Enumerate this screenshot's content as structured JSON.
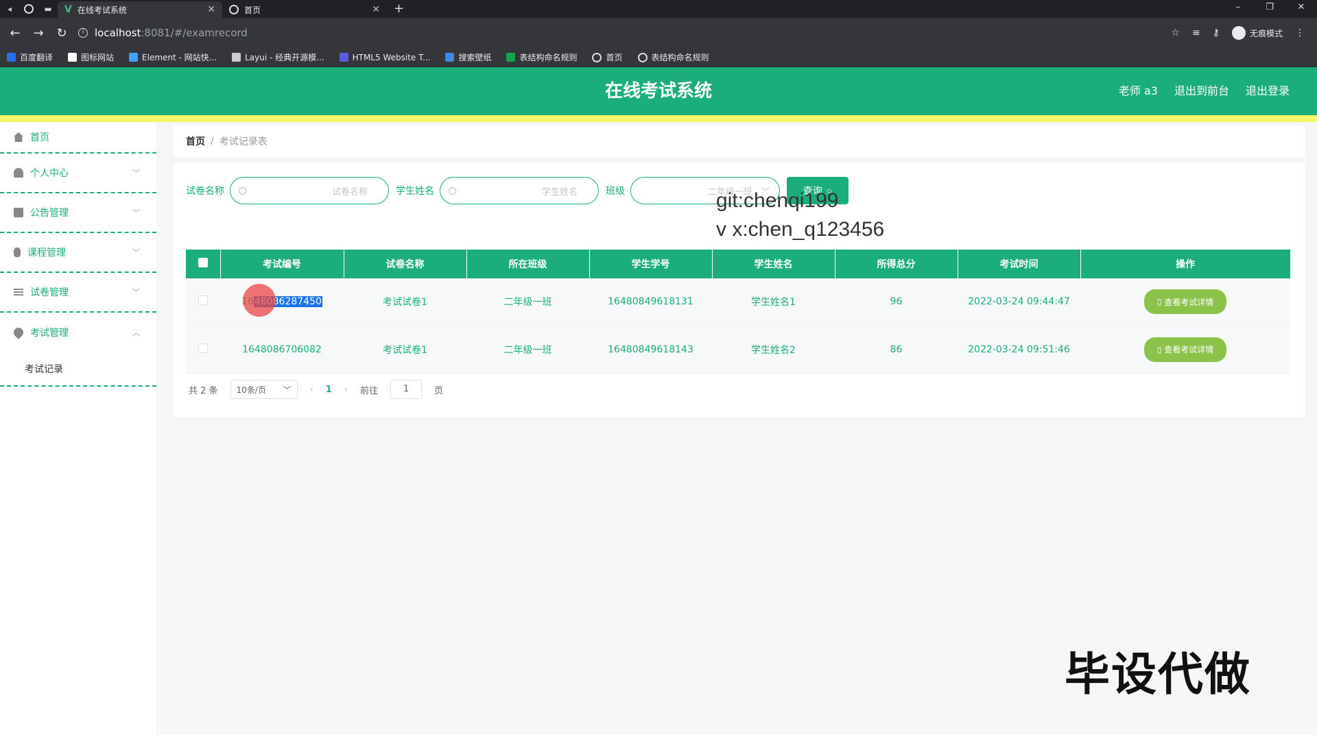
{
  "browser": {
    "tabs": [
      {
        "title": "在线考试系统",
        "active": true
      },
      {
        "title": "首页",
        "active": false
      }
    ],
    "url_host": "localhost",
    "url_path": ":8081/#/examrecord",
    "incognito_label": "无痕模式",
    "bookmarks": [
      {
        "label": "百度翻译",
        "color": "#2b6de8"
      },
      {
        "label": "图标网站",
        "color": "#ffffff"
      },
      {
        "label": "Element - 网站快...",
        "color": "#409eff"
      },
      {
        "label": "Layui - 经典开源模...",
        "color": "#cccccc"
      },
      {
        "label": "HTML5 Website T...",
        "color": "#5b5be0"
      },
      {
        "label": "搜索壁纸",
        "color": "#3b8ae8"
      },
      {
        "label": "表结构命名规则",
        "color": "#16a34a"
      },
      {
        "label": "首页",
        "color": "#dddddd"
      },
      {
        "label": "表结构命名规则",
        "color": "#dddddd"
      }
    ]
  },
  "header": {
    "title": "在线考试系统",
    "user": "老师 a3",
    "to_front": "退出到前台",
    "logout": "退出登录"
  },
  "sidebar": {
    "items": [
      {
        "label": "首页"
      },
      {
        "label": "个人中心"
      },
      {
        "label": "公告管理"
      },
      {
        "label": "课程管理"
      },
      {
        "label": "试卷管理"
      },
      {
        "label": "考试管理"
      }
    ],
    "sub_item": "考试记录"
  },
  "breadcrumb": {
    "home": "首页",
    "sep": "/",
    "current": "考试记录表"
  },
  "search": {
    "paper_label": "试卷名称",
    "paper_placeholder": "试卷名称",
    "student_label": "学生姓名",
    "student_placeholder": "学生姓名",
    "class_label": "班级",
    "class_value": "二年级一班",
    "query_button": "查询"
  },
  "table": {
    "headers": [
      "考试编号",
      "试卷名称",
      "所在班级",
      "学生学号",
      "学生姓名",
      "所得总分",
      "考试时间",
      "操作"
    ],
    "rows": [
      {
        "exam_no_pre": "16",
        "exam_no_sel": "48086287450",
        "paper": "考试试卷1",
        "class": "二年级一班",
        "student_no": "16480849618131",
        "student_name": "学生姓名1",
        "score": "96",
        "time": "2022-03-24 09:44:47",
        "action": "查看考试详情"
      },
      {
        "exam_no": "1648086706082",
        "paper": "考试试卷1",
        "class": "二年级一班",
        "student_no": "16480849618143",
        "student_name": "学生姓名2",
        "score": "86",
        "time": "2022-03-24 09:51:46",
        "action": "查看考试详情"
      }
    ]
  },
  "pager": {
    "total": "共 2 条",
    "size": "10条/页",
    "current": "1",
    "goto": "前往",
    "goto_value": "1",
    "page_unit": "页"
  },
  "overlay": {
    "git": "git:chenqi199",
    "wx": "v x:chen_q123456",
    "promo": "毕设代做"
  },
  "colors": {
    "primary": "#1bae7a",
    "accent_bar": "#f5f56a",
    "detail_button": "#8bc34a"
  }
}
